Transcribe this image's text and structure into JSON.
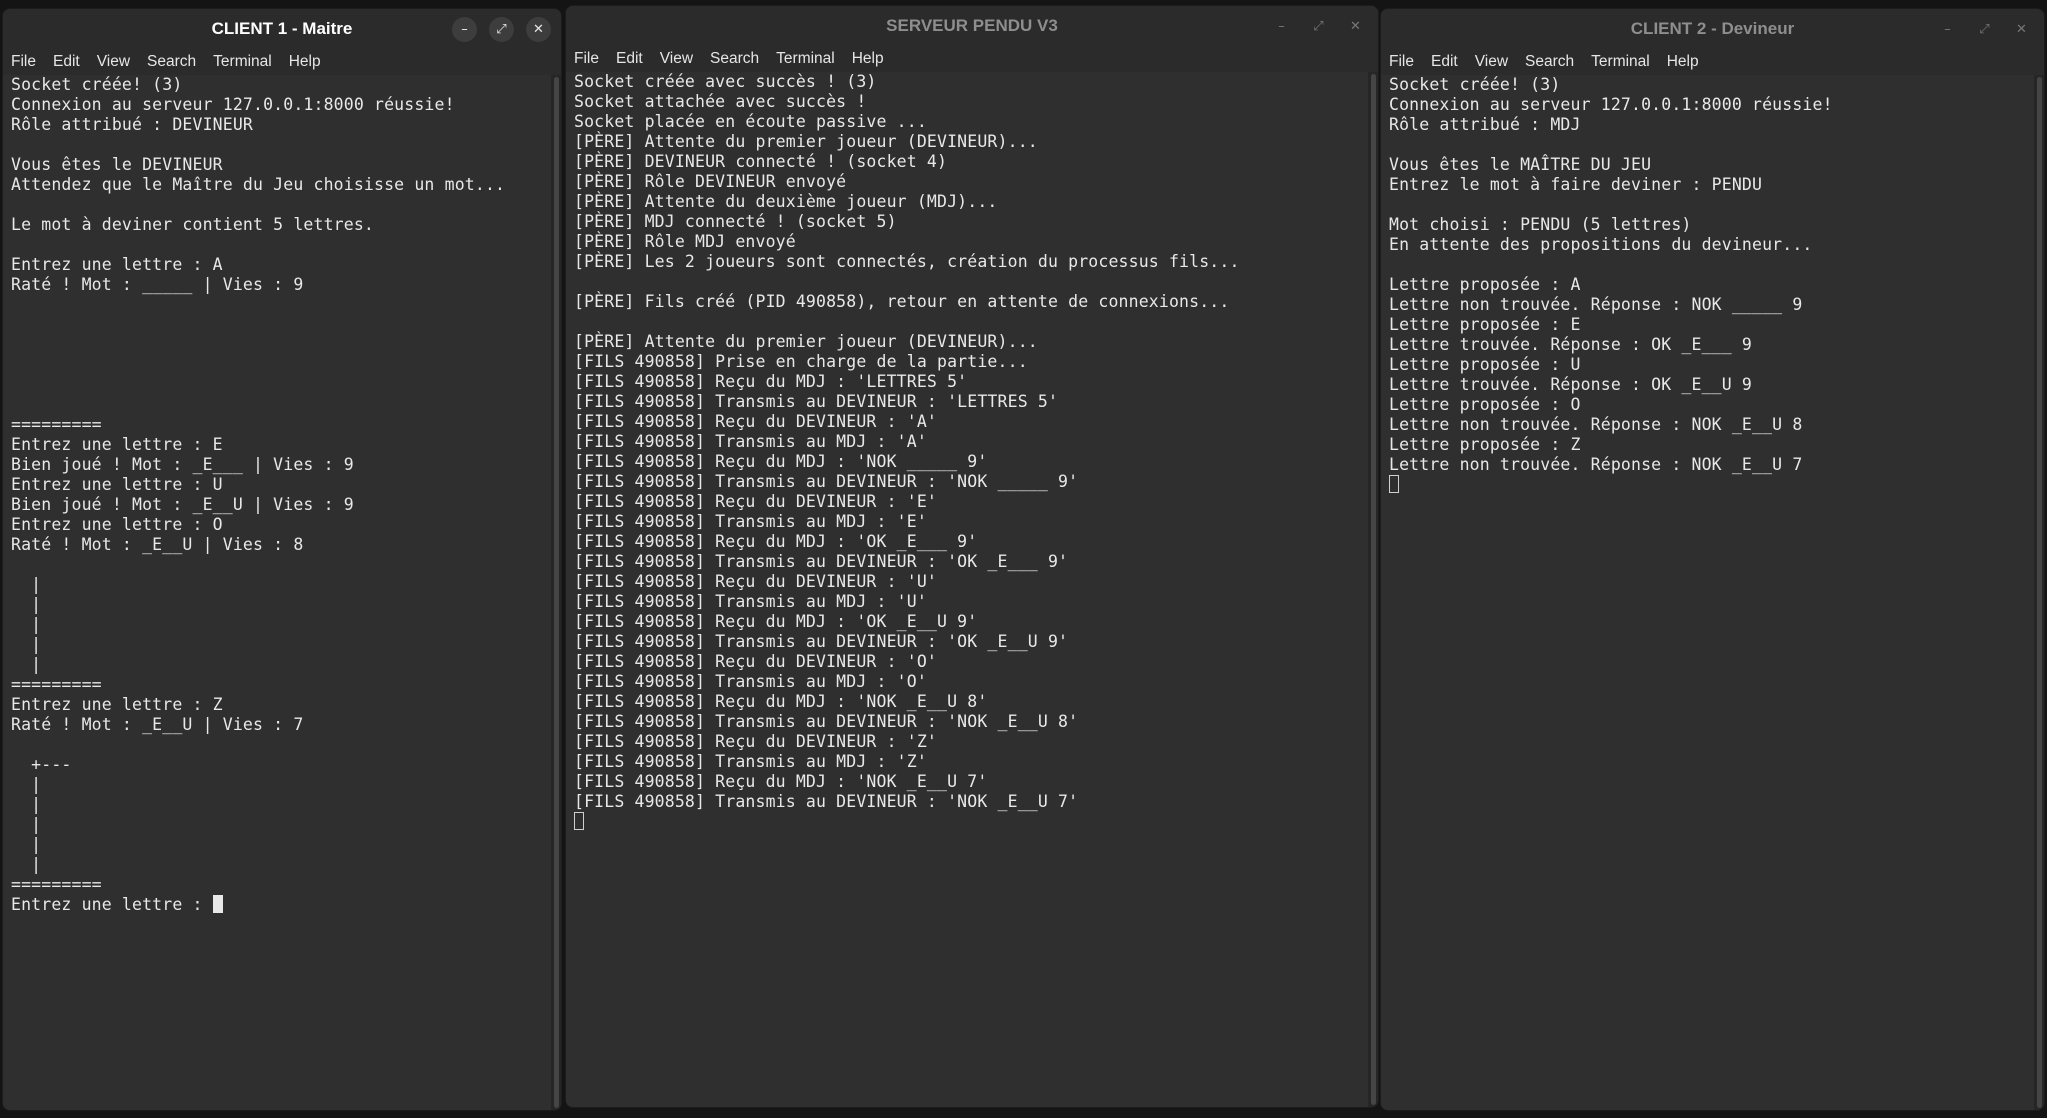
{
  "menu": [
    "File",
    "Edit",
    "View",
    "Search",
    "Terminal",
    "Help"
  ],
  "window_controls": {
    "minimize": "–",
    "maximize": "⤢",
    "close": "✕"
  },
  "client1": {
    "title": "CLIENT 1 - Maitre",
    "output": "Socket créée! (3)\nConnexion au serveur 127.0.0.1:8000 réussie!\nRôle attribué : DEVINEUR\n\nVous êtes le DEVINEUR\nAttendez que le Maître du Jeu choisisse un mot...\n\nLe mot à deviner contient 5 lettres.\n\nEntrez une lettre : A\nRaté ! Mot : _____ | Vies : 9\n\n\n\n\n\n\n=========\nEntrez une lettre : E\nBien joué ! Mot : _E___ | Vies : 9\nEntrez une lettre : U\nBien joué ! Mot : _E__U | Vies : 9\nEntrez une lettre : O\nRaté ! Mot : _E__U | Vies : 8\n\n  |\n  |\n  |\n  |\n  |\n=========\nEntrez une lettre : Z\nRaté ! Mot : _E__U | Vies : 7\n\n  +---\n  |\n  |\n  |\n  |\n  |\n=========\nEntrez une lettre : "
  },
  "server": {
    "title": "SERVEUR PENDU V3",
    "output": "Socket créée avec succès ! (3)\nSocket attachée avec succès !\nSocket placée en écoute passive ...\n[PÈRE] Attente du premier joueur (DEVINEUR)...\n[PÈRE] DEVINEUR connecté ! (socket 4)\n[PÈRE] Rôle DEVINEUR envoyé\n[PÈRE] Attente du deuxième joueur (MDJ)...\n[PÈRE] MDJ connecté ! (socket 5)\n[PÈRE] Rôle MDJ envoyé\n[PÈRE] Les 2 joueurs sont connectés, création du processus fils...\n\n[PÈRE] Fils créé (PID 490858), retour en attente de connexions...\n\n[PÈRE] Attente du premier joueur (DEVINEUR)...\n[FILS 490858] Prise en charge de la partie...\n[FILS 490858] Reçu du MDJ : 'LETTRES 5'\n[FILS 490858] Transmis au DEVINEUR : 'LETTRES 5'\n[FILS 490858] Reçu du DEVINEUR : 'A'\n[FILS 490858] Transmis au MDJ : 'A'\n[FILS 490858] Reçu du MDJ : 'NOK _____ 9'\n[FILS 490858] Transmis au DEVINEUR : 'NOK _____ 9'\n[FILS 490858] Reçu du DEVINEUR : 'E'\n[FILS 490858] Transmis au MDJ : 'E'\n[FILS 490858] Reçu du MDJ : 'OK _E___ 9'\n[FILS 490858] Transmis au DEVINEUR : 'OK _E___ 9'\n[FILS 490858] Reçu du DEVINEUR : 'U'\n[FILS 490858] Transmis au MDJ : 'U'\n[FILS 490858] Reçu du MDJ : 'OK _E__U 9'\n[FILS 490858] Transmis au DEVINEUR : 'OK _E__U 9'\n[FILS 490858] Reçu du DEVINEUR : 'O'\n[FILS 490858] Transmis au MDJ : 'O'\n[FILS 490858] Reçu du MDJ : 'NOK _E__U 8'\n[FILS 490858] Transmis au DEVINEUR : 'NOK _E__U 8'\n[FILS 490858] Reçu du DEVINEUR : 'Z'\n[FILS 490858] Transmis au MDJ : 'Z'\n[FILS 490858] Reçu du MDJ : 'NOK _E__U 7'\n[FILS 490858] Transmis au DEVINEUR : 'NOK _E__U 7'\n"
  },
  "client2": {
    "title": "CLIENT 2 - Devineur",
    "output": "Socket créée! (3)\nConnexion au serveur 127.0.0.1:8000 réussie!\nRôle attribué : MDJ\n\nVous êtes le MAÎTRE DU JEU\nEntrez le mot à faire deviner : PENDU\n\nMot choisi : PENDU (5 lettres)\nEn attente des propositions du devineur...\n\nLettre proposée : A\nLettre non trouvée. Réponse : NOK _____ 9\nLettre proposée : E\nLettre trouvée. Réponse : OK _E___ 9\nLettre proposée : U\nLettre trouvée. Réponse : OK _E__U 9\nLettre proposée : O\nLettre non trouvée. Réponse : NOK _E__U 8\nLettre proposée : Z\nLettre non trouvée. Réponse : NOK _E__U 7\n"
  }
}
